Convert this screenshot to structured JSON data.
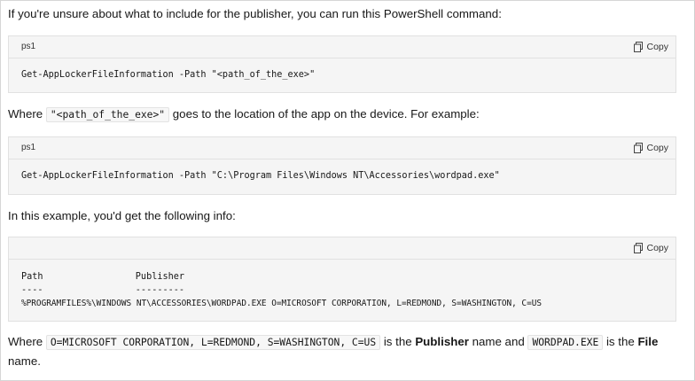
{
  "intro": "If you're unsure about what to include for the publisher, you can run this PowerShell command:",
  "block1": {
    "lang": "ps1",
    "copy_label": "Copy",
    "code": "Get-AppLockerFileInformation -Path \"<path_of_the_exe>\""
  },
  "where1": {
    "prefix": "Where ",
    "code": "\"<path_of_the_exe>\"",
    "suffix": " goes to the location of the app on the device. For example:"
  },
  "block2": {
    "lang": "ps1",
    "copy_label": "Copy",
    "code": "Get-AppLockerFileInformation -Path \"C:\\Program Files\\Windows NT\\Accessories\\wordpad.exe\""
  },
  "example_text": "In this example, you'd get the following info:",
  "block3": {
    "copy_label": "Copy",
    "line1": "Path                 Publisher",
    "line2": "----                 ---------",
    "line3": "%PROGRAMFILES%\\WINDOWS NT\\ACCESSORIES\\WORDPAD.EXE O=MICROSOFT CORPORATION, L=REDMOND, S=WASHINGTON, C=US"
  },
  "where2": {
    "prefix": "Where ",
    "code1": "O=MICROSOFT CORPORATION, L=REDMOND, S=WASHINGTON, C=US",
    "mid1": " is the ",
    "bold1": "Publisher",
    "mid2": " name and ",
    "code2": "WORDPAD.EXE",
    "mid3": " is the ",
    "bold2": "File",
    "line2": "name."
  }
}
